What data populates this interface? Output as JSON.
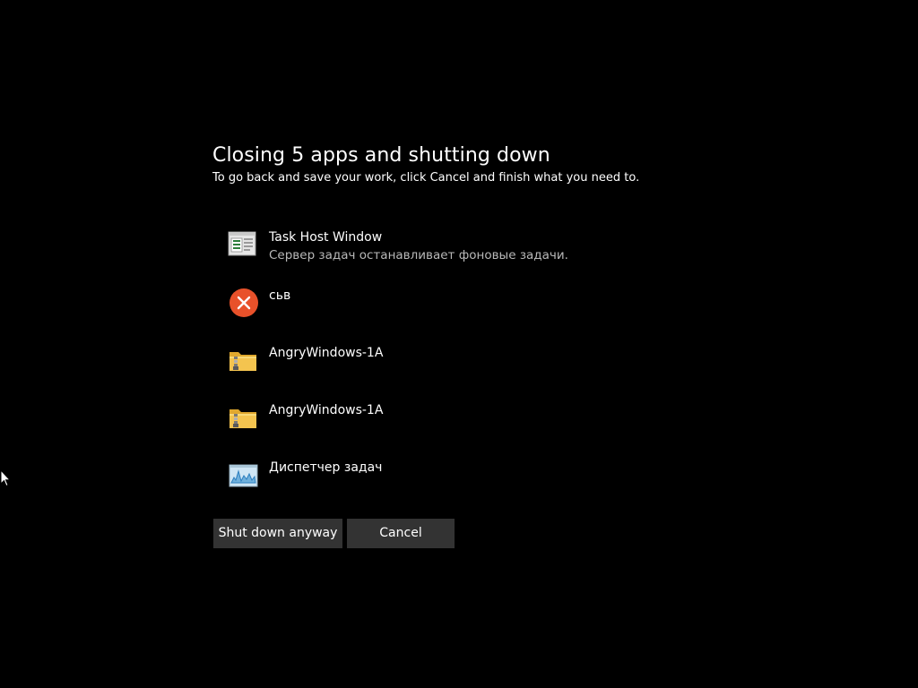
{
  "dialog": {
    "title": "Closing 5 apps and shutting down",
    "subtitle": "To go back and save your work, click Cancel and finish what you need to."
  },
  "apps": [
    {
      "name": "Task Host Window",
      "description": "Сервер задач останавливает фоновые задачи.",
      "icon": "task-host-window-icon"
    },
    {
      "name": "сьв",
      "description": "",
      "icon": "error-icon"
    },
    {
      "name": "AngryWindows-1A",
      "description": "",
      "icon": "zip-folder-icon"
    },
    {
      "name": "AngryWindows-1A",
      "description": "",
      "icon": "zip-folder-icon"
    },
    {
      "name": "Диспетчер задач",
      "description": "",
      "icon": "task-manager-icon"
    }
  ],
  "buttons": {
    "shutdown_label": "Shut down anyway",
    "cancel_label": "Cancel"
  },
  "colors": {
    "background": "#000000",
    "button_bg": "#333333",
    "error_accent": "#e8512a",
    "folder_yellow": "#f4c44f",
    "secondary_text": "#b8b8b8"
  }
}
